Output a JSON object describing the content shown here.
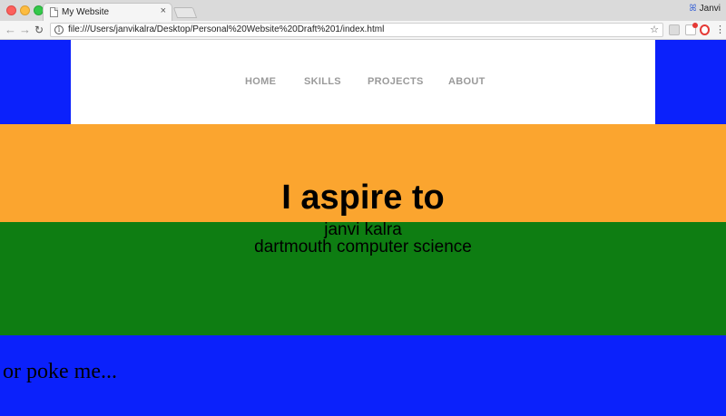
{
  "browser": {
    "tab_title": "My Website",
    "tab_close": "×",
    "profile_name": "Janvi",
    "url": "file:///Users/janvikalra/Desktop/Personal%20Website%20Draft%201/index.html",
    "icons": {
      "back": "←",
      "forward": "→",
      "reload": "↻",
      "info": "i",
      "star": "☆",
      "menu": "⋮",
      "profile": "ꕤ"
    }
  },
  "nav": {
    "items": [
      "HOME",
      "SKILLS",
      "PROJECTS",
      "ABOUT"
    ]
  },
  "hero": {
    "title": "I aspire to",
    "name": "janvi kalra",
    "subtitle": "dartmouth computer science"
  },
  "footer": {
    "poke_text": "or poke me..."
  },
  "colors": {
    "blue": "#0b21fb",
    "orange": "#fba52f",
    "green": "#0e7d12",
    "nav_text": "#9a9a9a"
  }
}
